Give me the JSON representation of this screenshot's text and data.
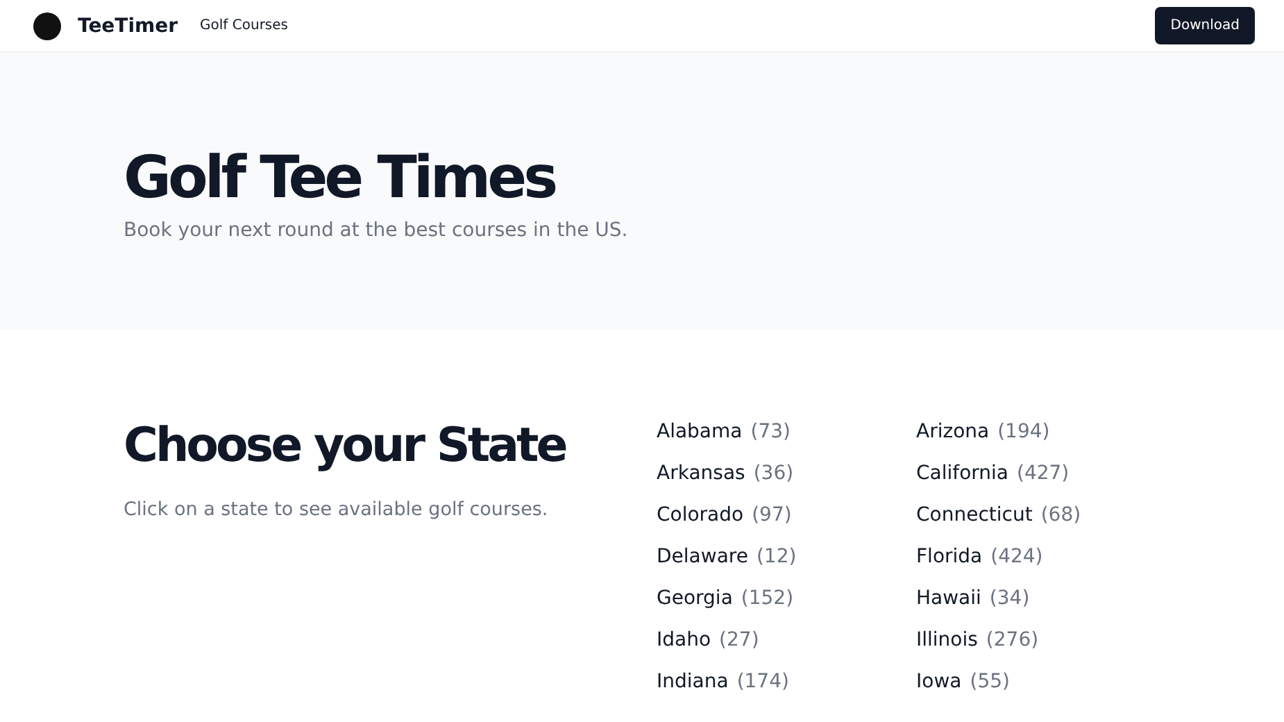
{
  "header": {
    "brand": "TeeTimer",
    "nav": [
      "Golf Courses"
    ],
    "button": "Download"
  },
  "hero": {
    "title": "Golf Tee Times",
    "subtitle": "Book your next round at the best courses in the US."
  },
  "states_section": {
    "title": "Choose your State",
    "description": "Click on a state to see available golf courses.",
    "states": [
      {
        "name": "Alabama",
        "count": "(73)"
      },
      {
        "name": "Arizona",
        "count": "(194)"
      },
      {
        "name": "Arkansas",
        "count": "(36)"
      },
      {
        "name": "California",
        "count": "(427)"
      },
      {
        "name": "Colorado",
        "count": "(97)"
      },
      {
        "name": "Connecticut",
        "count": "(68)"
      },
      {
        "name": "Delaware",
        "count": "(12)"
      },
      {
        "name": "Florida",
        "count": "(424)"
      },
      {
        "name": "Georgia",
        "count": "(152)"
      },
      {
        "name": "Hawaii",
        "count": "(34)"
      },
      {
        "name": "Idaho",
        "count": "(27)"
      },
      {
        "name": "Illinois",
        "count": "(276)"
      },
      {
        "name": "Indiana",
        "count": "(174)"
      },
      {
        "name": "Iowa",
        "count": "(55)"
      }
    ]
  }
}
